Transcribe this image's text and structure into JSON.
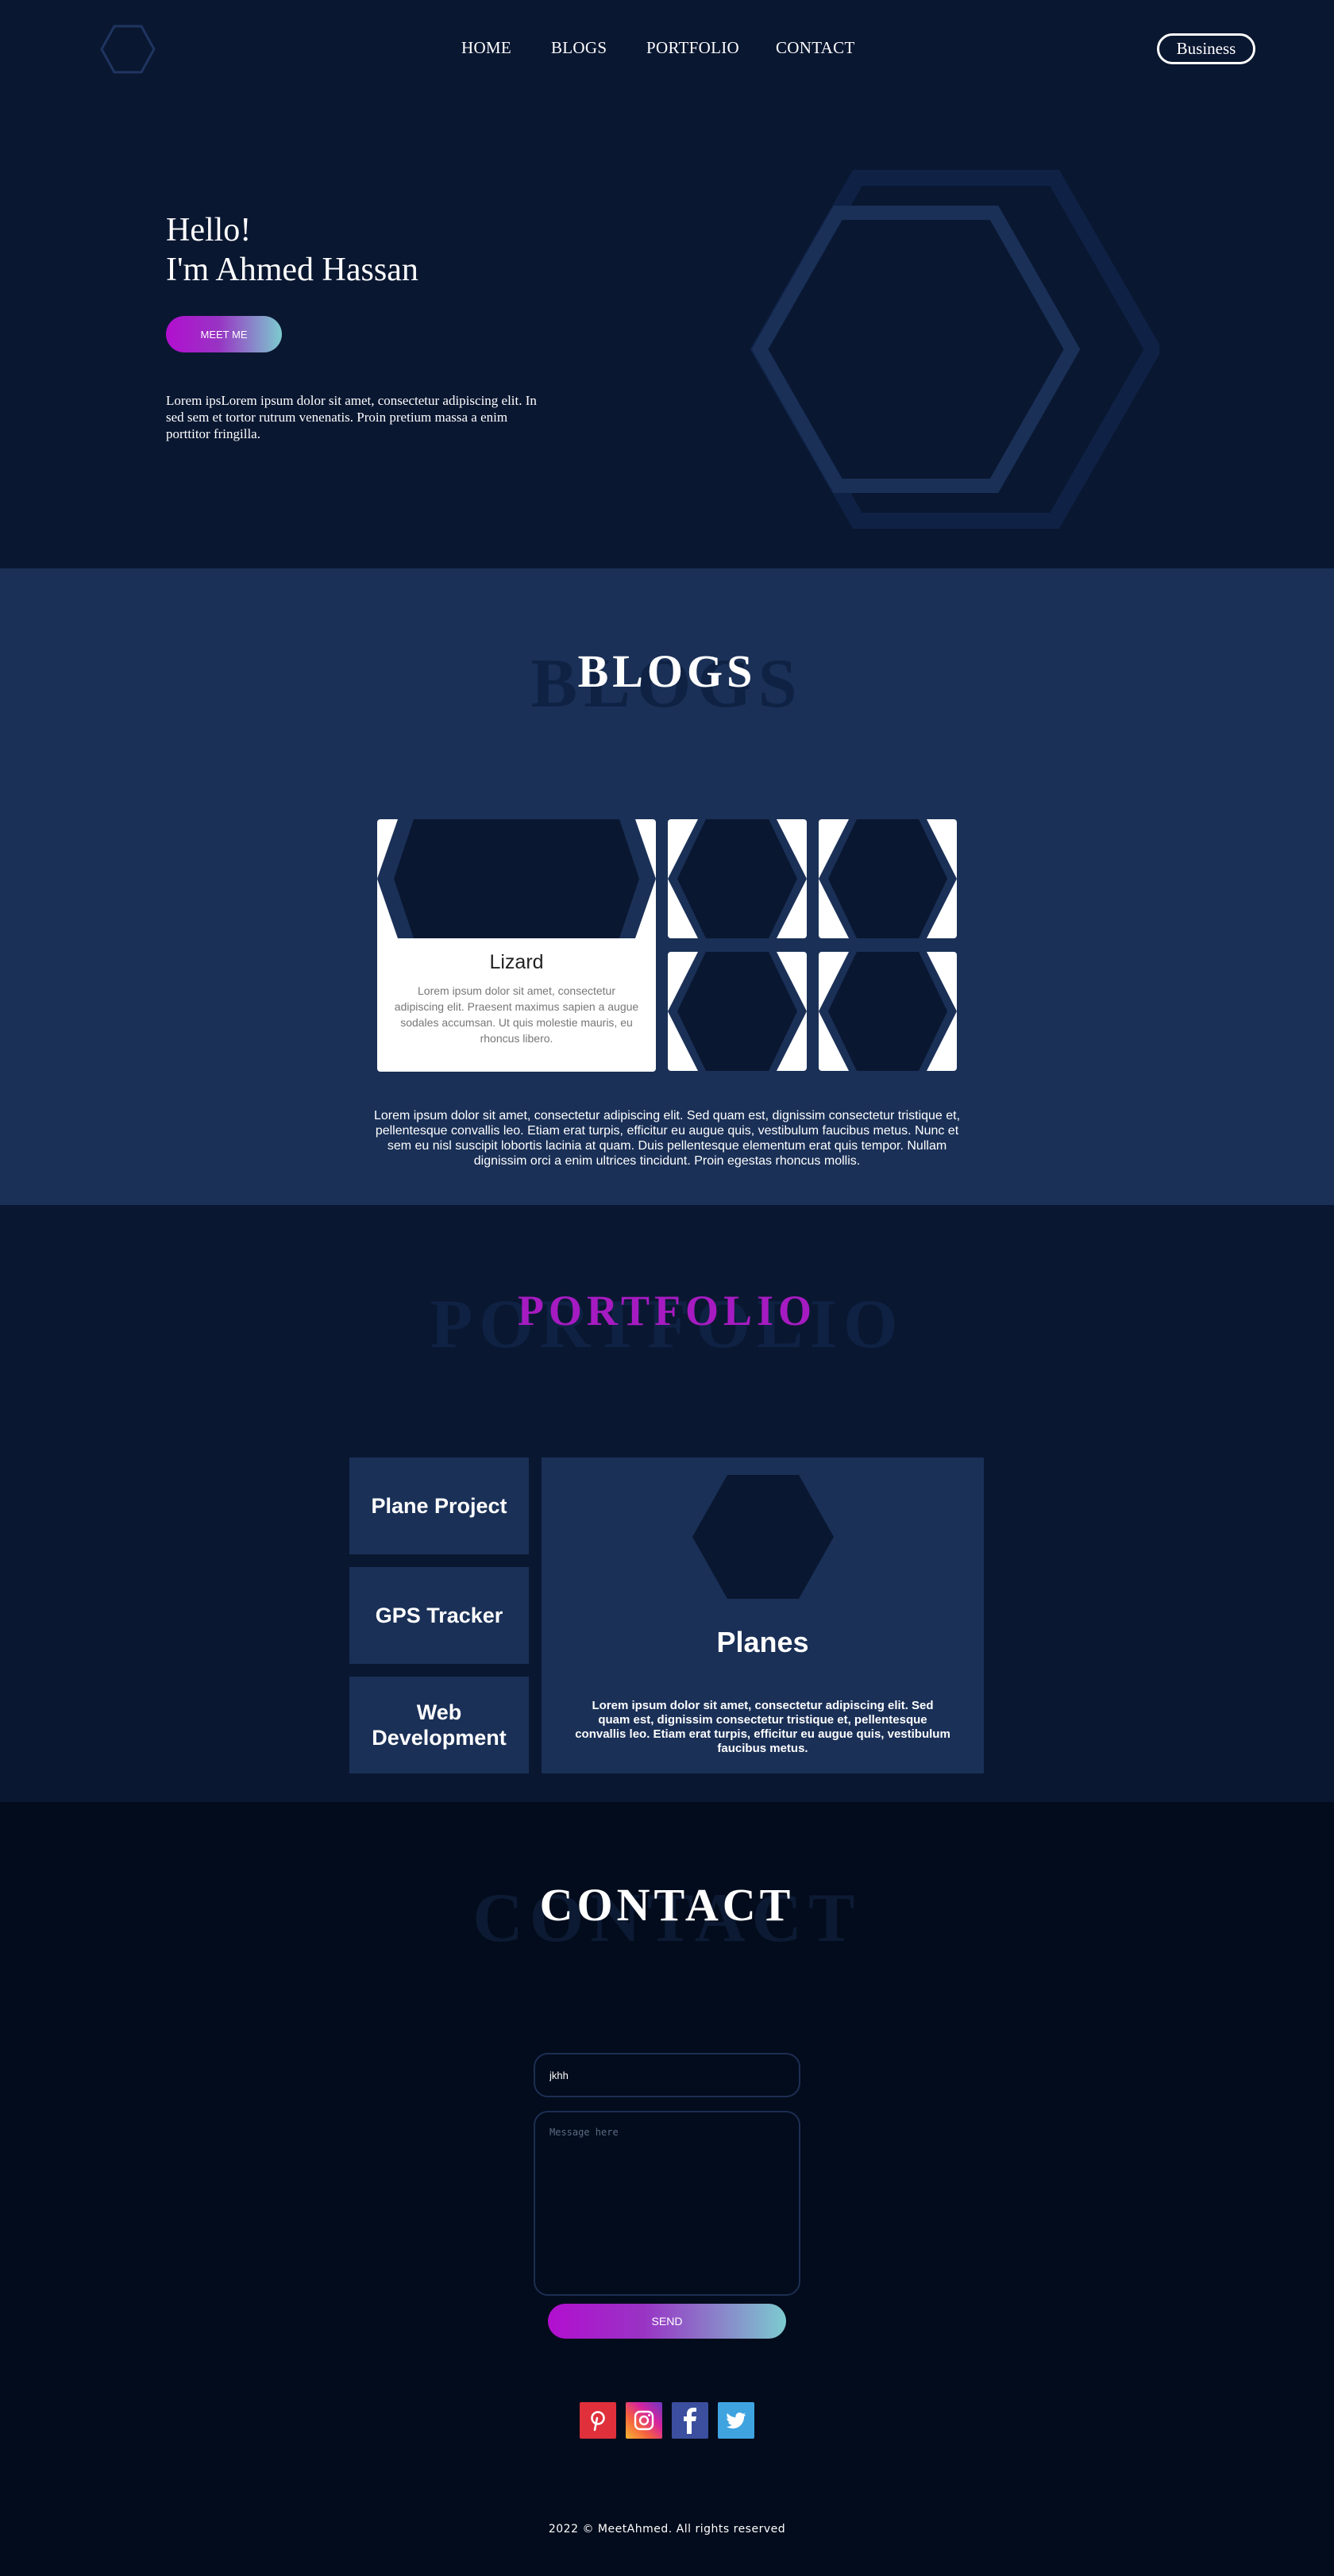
{
  "nav": {
    "links": [
      "HOME",
      "BLOGS",
      "PORTFOLIO",
      "CONTACT"
    ],
    "business_label": "Business"
  },
  "hero": {
    "greeting": "Hello!",
    "name_line": "I'm Ahmed Hassan",
    "meet_button": "MEET ME",
    "text": "Lorem ipsLorem ipsum dolor sit amet, consectetur adipiscing elit. In sed sem et tortor rutrum venenatis. Proin pretium massa a enim porttitor fringilla."
  },
  "blogs": {
    "ghost": "BLOGS",
    "title": "BLOGS",
    "featured_title": "Lizard",
    "featured_desc": "Lorem ipsum dolor sit amet, consectetur adipiscing elit. Praesent maximus sapien a augue sodales accumsan. Ut quis molestie mauris, eu rhoncus libero.",
    "paragraph": "Lorem ipsum dolor sit amet, consectetur adipiscing elit. Sed quam est, dignissim consectetur tristique et, pellentesque convallis leo. Etiam erat turpis, efficitur eu augue quis, vestibulum faucibus metus. Nunc et sem eu nisl suscipit lobortis lacinia at quam. Duis pellentesque elementum erat quis tempor. Nullam dignissim orci a enim ultrices tincidunt. Proin egestas rhoncus mollis."
  },
  "portfolio": {
    "ghost": "PORTFOLIO",
    "title": "PORTFOLIO",
    "tabs": [
      "Plane Project",
      "GPS Tracker",
      "Web Development"
    ],
    "detail_title": "Planes",
    "detail_text": "Lorem ipsum dolor sit amet, consectetur adipiscing elit. Sed quam est, dignissim consectetur tristique et, pellentesque convallis leo. Etiam erat turpis, efficitur eu augue quis, vestibulum faucibus metus."
  },
  "contact": {
    "ghost": "CONTACT",
    "title": "CONTACT",
    "name_value": "jkhh",
    "message_placeholder": "Message here",
    "send_label": "SEND",
    "social_icons": [
      "pinterest-icon",
      "instagram-icon",
      "facebook-icon",
      "twitter-icon"
    ]
  },
  "footer": {
    "text": "2022 © MeetAhmed. All rights reserved"
  },
  "colors": {
    "hero_bg": "#0a1731",
    "blogs_bg": "#1a3057",
    "contact_bg": "#030c1c",
    "accent_purple": "#a61bc1",
    "accent_teal": "#7ccbcf"
  }
}
